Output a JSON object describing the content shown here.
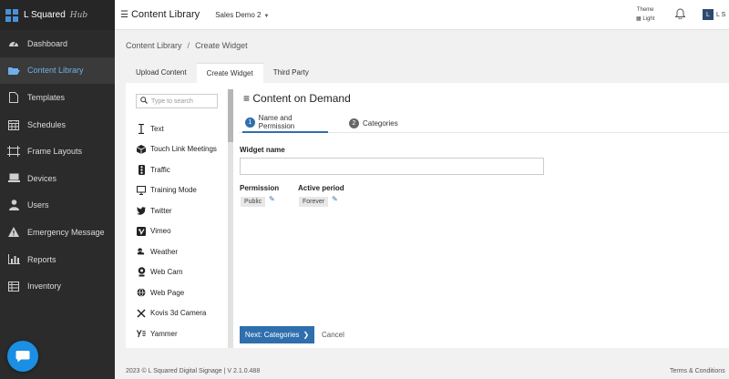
{
  "brand": {
    "name": "L Squared",
    "suffix": "Hub"
  },
  "sidebar": {
    "items": [
      {
        "label": "Dashboard",
        "icon": "dashboard-icon"
      },
      {
        "label": "Content Library",
        "icon": "folder-icon",
        "active": true
      },
      {
        "label": "Templates",
        "icon": "file-icon"
      },
      {
        "label": "Schedules",
        "icon": "calendar-icon"
      },
      {
        "label": "Frame Layouts",
        "icon": "frame-icon"
      },
      {
        "label": "Devices",
        "icon": "devices-icon"
      },
      {
        "label": "Users",
        "icon": "user-icon"
      },
      {
        "label": "Emergency Message",
        "icon": "warning-icon"
      },
      {
        "label": "Reports",
        "icon": "chart-icon"
      },
      {
        "label": "Inventory",
        "icon": "table-icon"
      }
    ]
  },
  "header": {
    "title": "Content Library",
    "account": "Sales Demo 2",
    "theme_label": "Theme",
    "theme_value": "Light",
    "user_initial": "L",
    "user_name": "L S"
  },
  "breadcrumb": {
    "root": "Content Library",
    "separator": "/",
    "current": "Create Widget"
  },
  "tabs": [
    {
      "label": "Upload Content"
    },
    {
      "label": "Create Widget",
      "active": true
    },
    {
      "label": "Third Party"
    }
  ],
  "widget_list": {
    "search_placeholder": "Type to search",
    "items": [
      {
        "label": "Text",
        "icon": "text-cursor-icon"
      },
      {
        "label": "Touch Link Meetings",
        "icon": "cube-icon"
      },
      {
        "label": "Traffic",
        "icon": "traffic-light-icon"
      },
      {
        "label": "Training Mode",
        "icon": "monitor-icon"
      },
      {
        "label": "Twitter",
        "icon": "twitter-icon"
      },
      {
        "label": "Vimeo",
        "icon": "vimeo-icon"
      },
      {
        "label": "Weather",
        "icon": "weather-icon"
      },
      {
        "label": "Web Cam",
        "icon": "webcam-icon"
      },
      {
        "label": "Web Page",
        "icon": "globe-icon"
      },
      {
        "label": "Kovis 3d Camera",
        "icon": "cross-icon"
      },
      {
        "label": "Yammer",
        "icon": "yammer-icon"
      }
    ]
  },
  "panel": {
    "title": "Content on Demand",
    "steps": [
      {
        "num": "1",
        "label": "Name and Permission",
        "active": true
      },
      {
        "num": "2",
        "label": "Categories"
      }
    ],
    "widget_name_label": "Widget name",
    "widget_name_value": "",
    "permission_label": "Permission",
    "permission_value": "Public",
    "active_period_label": "Active period",
    "active_period_value": "Forever",
    "next_label": "Next: Categories",
    "cancel_label": "Cancel"
  },
  "footer": {
    "copyright": "2023 © L Squared Digital Signage | V 2.1.0.488",
    "terms": "Terms & Conditions"
  },
  "colors": {
    "accent": "#2f6fad",
    "sidebar_bg": "#2b2b2b",
    "chat_bubble": "#1a8fe3"
  }
}
